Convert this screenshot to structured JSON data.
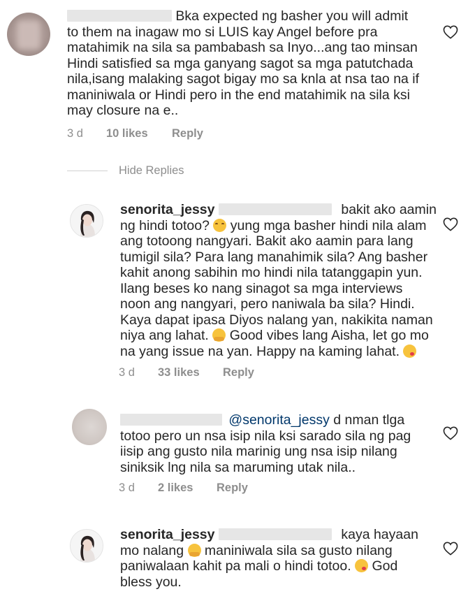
{
  "comments": [
    {
      "lines": [
        "Bka expected ng basher you will admit",
        "to them na inagaw mo si LUIS kay Angel before pra",
        "matahimik na sila sa pambabash sa Inyo...ang tao minsan",
        "Hindi satisfied sa mga ganyang sagot sa mga patutchada",
        "nila,isang malaking sagot bigay mo sa knla at nsa tao na if",
        "maniniwala or Hindi pero in the end matahimik na sila ksi",
        "may closure na e.."
      ],
      "time": "3 d",
      "likes": "10 likes",
      "reply": "Reply"
    }
  ],
  "hide_replies": "Hide Replies",
  "replies": [
    {
      "username": "senorita_jessy",
      "first_tail": "bakit ako aamin",
      "lines": [
        "ng hindi totoo?",
        "yung mga basher hindi nila alam",
        "ang totoong nangyari. Bakit ako aamin para lang",
        "tumigil sila? Para lang manahimik sila? Ang basher",
        "kahit anong sabihin mo hindi nila tatanggapin yun.",
        "Ilang beses ko nang sinagot sa mga interviews",
        "noon ang nangyari, pero naniwala ba sila? Hindi.",
        "Kaya dapat ipasa Diyos nalang yan, nakikita naman",
        "niya ang lahat.",
        "Good vibes lang Aisha, let go mo",
        "na yang issue na yan. Happy na kaming lahat."
      ],
      "time": "3 d",
      "likes": "33 likes",
      "reply": "Reply"
    },
    {
      "mention": "@senorita_jessy",
      "first_tail": "d nman tlga",
      "lines": [
        "totoo pero un nsa isip nila ksi sarado sila ng pag",
        "iisip ang gusto nila marinig ung nsa isip nilang",
        "siniksik lng nila sa maruming utak nila.."
      ],
      "time": "3 d",
      "likes": "2 likes",
      "reply": "Reply"
    },
    {
      "username": "senorita_jessy",
      "first_tail": "kaya hayaan",
      "lines": [
        "mo nalang",
        "maniniwala sila sa gusto nilang",
        "paniwalaan kahit pa mali o hindi totoo.",
        "God",
        "bless you."
      ]
    }
  ],
  "icons": [
    "heart-icon",
    "smiling-face-icon",
    "hugging-face-icon",
    "face-blowing-kiss-icon"
  ]
}
